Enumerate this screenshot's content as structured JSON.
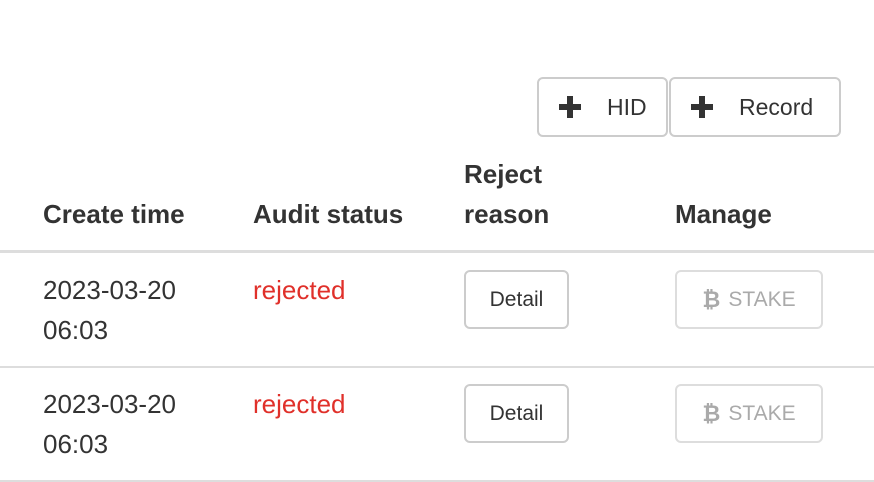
{
  "toolbar": {
    "hid_label": "HID",
    "record_label": "Record"
  },
  "table": {
    "headers": {
      "create_time": "Create time",
      "audit_status": "Audit status",
      "reject_reason": "Reject\nreason",
      "manage": "Manage"
    },
    "rows": [
      {
        "create_time": "2023-03-20\n06:03",
        "audit_status": "rejected",
        "detail_label": "Detail",
        "stake_label": "STAKE",
        "stake_icon": "₿"
      },
      {
        "create_time": "2023-03-20\n06:03",
        "audit_status": "rejected",
        "detail_label": "Detail",
        "stake_label": "STAKE",
        "stake_icon": "₿"
      }
    ]
  },
  "colors": {
    "status_rejected": "#e0302a",
    "border": "#cccccc",
    "text": "#333333",
    "disabled": "#aaaaaa"
  }
}
